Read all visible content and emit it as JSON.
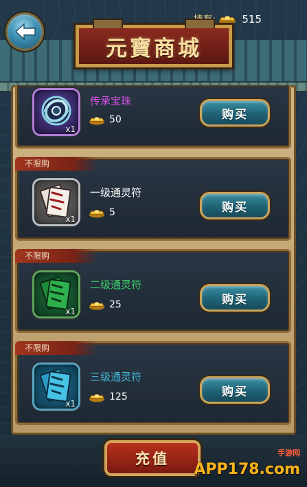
{
  "header": {
    "holding_label": "持有:",
    "holding_value": "515",
    "title": "元寶商城"
  },
  "items": [
    {
      "tag": "",
      "name": "传承宝珠",
      "qty": "x1",
      "price": "50",
      "buy_label": "购买",
      "name_color": "#d452e6",
      "icon": "heritage-orb-icon"
    },
    {
      "tag": "不限购",
      "name": "一级通灵符",
      "qty": "x1",
      "price": "5",
      "buy_label": "购买",
      "name_color": "#ffffff",
      "icon": "talisman-white-icon"
    },
    {
      "tag": "不限购",
      "name": "二级通灵符",
      "qty": "x1",
      "price": "25",
      "buy_label": "购买",
      "name_color": "#3fd36a",
      "icon": "talisman-green-icon"
    },
    {
      "tag": "不限购",
      "name": "三级通灵符",
      "qty": "x1",
      "price": "125",
      "buy_label": "购买",
      "name_color": "#43b8d8",
      "icon": "talisman-blue-icon"
    }
  ],
  "footer": {
    "recharge_label": "充值",
    "watermark_main": "APP178.com",
    "watermark_sub": "手游网"
  }
}
